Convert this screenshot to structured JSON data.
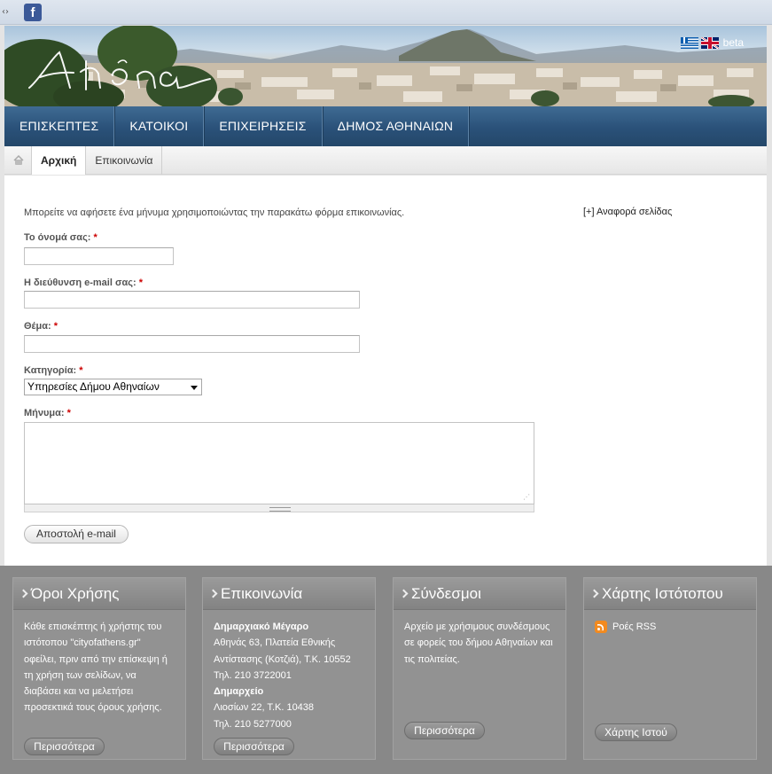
{
  "top": {
    "facebook_glyph": "f",
    "arrows": "‹›"
  },
  "header": {
    "logo_alt": "Αθήνα",
    "beta": "beta"
  },
  "nav": {
    "items": [
      {
        "label": "ΕΠΙΣΚΕΠΤΕΣ"
      },
      {
        "label": "ΚΑΤΟΙΚΟΙ"
      },
      {
        "label": "ΕΠΙΧΕΙΡΗΣΕΙΣ"
      },
      {
        "label": "ΔΗΜΟΣ ΑΘΗΝΑΙΩΝ"
      }
    ]
  },
  "tabs": [
    {
      "label": "Αρχική"
    },
    {
      "label": "Επικοινωνία"
    }
  ],
  "form": {
    "intro": "Μπορείτε να αφήσετε ένα μήνυμα χρησιμοποιώντας την παρακάτω φόρμα επικοινωνίας.",
    "report_link": "[+] Αναφορά σελίδας",
    "required_mark": "*",
    "name_label": "Το όνομά σας:",
    "name_value": "",
    "email_label": "Η διεύθυνση e-mail σας:",
    "email_value": "",
    "subject_label": "Θέμα:",
    "subject_value": "",
    "category_label": "Κατηγορία:",
    "category_value": "Υπηρεσίες Δήμου Αθηναίων",
    "message_label": "Μήνυμα:",
    "message_value": "",
    "submit": "Αποστολή e-mail"
  },
  "footer": {
    "terms": {
      "title": "Όροι Χρήσης",
      "text": "Κάθε επισκέπτης ή χρήστης του ιστότοπου \"cityofathens.gr\" οφείλει, πριν από την επίσκεψη ή τη χρήση των σελίδων, να διαβάσει και να μελετήσει προσεκτικά τους όρους χρήσης.",
      "button": "Περισσότερα"
    },
    "contact": {
      "title": "Επικοινωνία",
      "hall_title": "Δημαρχιακό Μέγαρο",
      "hall_address": "Αθηνάς 63, Πλατεία Εθνικής Αντίστασης (Κοτζιά), Τ.Κ. 10552",
      "hall_phone": "Τηλ. 210 3722001",
      "office_title": "Δημαρχείο",
      "office_address": "Λιοσίων 22, Τ.Κ. 10438",
      "office_phone": "Τηλ. 210 5277000",
      "button": "Περισσότερα"
    },
    "links": {
      "title": "Σύνδεσμοι",
      "text": "Αρχείο με χρήσιμους συνδέσμους σε φορείς του δήμου Αθηναίων και τις πολιτείας.",
      "button": "Περισσότερα"
    },
    "sitemap": {
      "title": "Χάρτης Ιστότοπου",
      "rss": "Ροές RSS",
      "button": "Χάρτης Ιστού"
    }
  }
}
